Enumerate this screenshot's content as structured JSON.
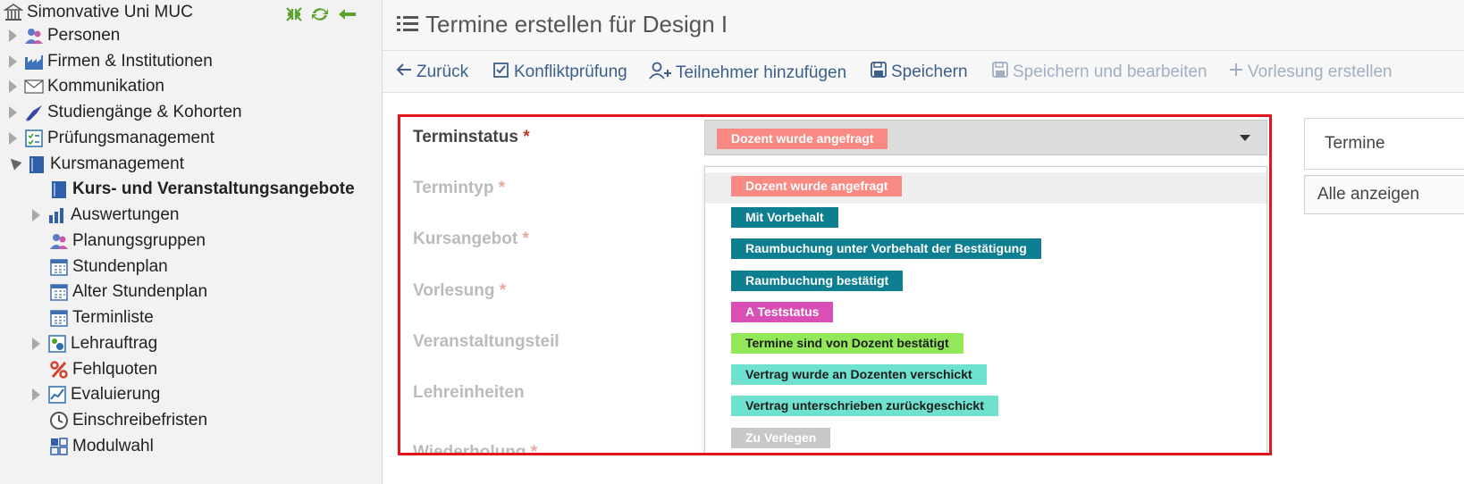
{
  "sidebar": {
    "root_label": "Simonvative Uni MUC",
    "items": [
      {
        "label": "Personen"
      },
      {
        "label": "Firmen & Institutionen"
      },
      {
        "label": "Kommunikation"
      },
      {
        "label": "Studiengänge & Kohorten"
      },
      {
        "label": "Prüfungsmanagement"
      },
      {
        "label": "Kursmanagement"
      }
    ],
    "children": [
      {
        "label": "Kurs- und Veranstaltungsangebote"
      },
      {
        "label": "Auswertungen"
      },
      {
        "label": "Planungsgruppen"
      },
      {
        "label": "Stundenplan"
      },
      {
        "label": "Alter Stundenplan"
      },
      {
        "label": "Terminliste"
      },
      {
        "label": "Lehrauftrag"
      },
      {
        "label": "Fehlquoten"
      },
      {
        "label": "Evaluierung"
      },
      {
        "label": "Einschreibefristen"
      },
      {
        "label": "Modulwahl"
      }
    ]
  },
  "header": {
    "title": "Termine erstellen für Design I"
  },
  "toolbar": {
    "back": "Zurück",
    "conflict": "Konfliktprüfung",
    "add_participants": "Teilnehmer hinzufügen",
    "save": "Speichern",
    "save_edit": "Speichern und bearbeiten",
    "create_lecture": "Vorlesung erstellen"
  },
  "form": {
    "labels": {
      "terminstatus": "Terminstatus",
      "termintyp": "Termintyp",
      "kursangebot": "Kursangebot",
      "vorlesung": "Vorlesung",
      "veranstaltungsteil": "Veranstaltungsteil",
      "lehreinheiten": "Lehreinheiten",
      "wiederholung": "Wiederholung"
    },
    "required_mark": "*",
    "selected_status": "Dozent wurde angefragt",
    "options": [
      {
        "label": "Dozent wurde angefragt",
        "bg": "#f98a83",
        "fg": "#ffffff"
      },
      {
        "label": "Mit Vorbehalt",
        "bg": "#0e7e91",
        "fg": "#ffffff"
      },
      {
        "label": "Raumbuchung unter Vorbehalt der Bestätigung",
        "bg": "#0e7e91",
        "fg": "#ffffff"
      },
      {
        "label": "Raumbuchung bestätigt",
        "bg": "#0e7e91",
        "fg": "#ffffff"
      },
      {
        "label": "A Teststatus",
        "bg": "#d94fb5",
        "fg": "#ffffff"
      },
      {
        "label": "Termine sind von Dozent bestätigt",
        "bg": "#93e85a",
        "fg": "#1c1c1c"
      },
      {
        "label": "Vertrag wurde an Dozenten verschickt",
        "bg": "#6fe2cf",
        "fg": "#1c1c1c"
      },
      {
        "label": "Vertrag unterschrieben zurückgeschickt",
        "bg": "#6fe2cf",
        "fg": "#1c1c1c"
      },
      {
        "label": "Zu Verlegen",
        "bg": "#c8c8c8",
        "fg": "#ffffff"
      }
    ]
  },
  "right_panel": {
    "tab": "Termine",
    "button": "Alle anzeigen"
  },
  "colors": {
    "highlight_border": "#e3141c",
    "link": "#3b5f8a",
    "disabled_link": "#9fb0c4"
  }
}
